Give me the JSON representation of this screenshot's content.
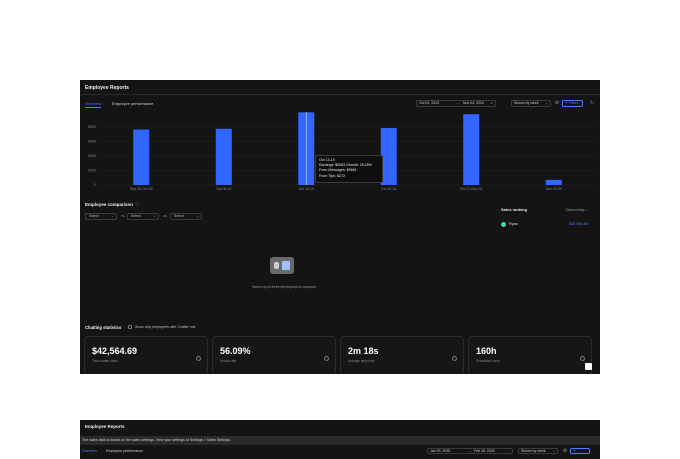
{
  "header": {
    "title": "Employee Reports"
  },
  "tabs": [
    {
      "label": "Overview"
    },
    {
      "label": "Employee performance"
    }
  ],
  "controls": {
    "date_from": "Oct 04, 2024",
    "date_to": "Nov 04, 2024",
    "group_by": "Shown by week",
    "filters_label": "Filters"
  },
  "chart_data": {
    "type": "bar",
    "categories": [
      "Sep 29-Oct 05",
      "Oct 06-12",
      "Oct 13-19",
      "Oct 20-26",
      "Oct 27-Nov 02",
      "Nov 03-09"
    ],
    "values": [
      7600,
      7700,
      9953,
      7800,
      9700,
      700
    ],
    "y_ticks": [
      "8000",
      "6000",
      "4000",
      "2000",
      "0"
    ],
    "ylim": [
      0,
      10000
    ],
    "color": "#3366ff",
    "tooltip": {
      "title": "Oct 13-19",
      "line1": "Earnings: $9953 Growth: 28.25%",
      "line2": "From Messages: $9661",
      "line3": "From Tips: $272"
    }
  },
  "comparison": {
    "title": "Employee comparison",
    "select_placeholder": "Select",
    "vs_label": "vs.",
    "empty_message": "Select up to three employees to compare"
  },
  "ranking": {
    "title": "Sales ranking",
    "sort_label": "Descending",
    "items": [
      {
        "name": "Ryan",
        "value": "$42,564.69"
      }
    ]
  },
  "stats": {
    "title": "Chatting statistics",
    "checkbox_label": "Show only employees with Chatter role",
    "cards": [
      {
        "value": "$42,564.69",
        "label": "Total chatter sales"
      },
      {
        "value": "56.09%",
        "label": "Unlock rate"
      },
      {
        "value": "2m 18s",
        "label": "Average reply time"
      },
      {
        "value": "160h",
        "label": "Scheduled hours"
      }
    ]
  },
  "second_panel": {
    "title": "Employee Reports",
    "notice": "The sales data is based on the sales settings. View your settings at Settings > Sales Settings.",
    "tabs": [
      {
        "label": "Overview"
      },
      {
        "label": "Employee performance"
      }
    ],
    "date_from": "Jan 29, 2025",
    "date_to": "Feb 28, 2025",
    "group_by": "Shown by week"
  }
}
